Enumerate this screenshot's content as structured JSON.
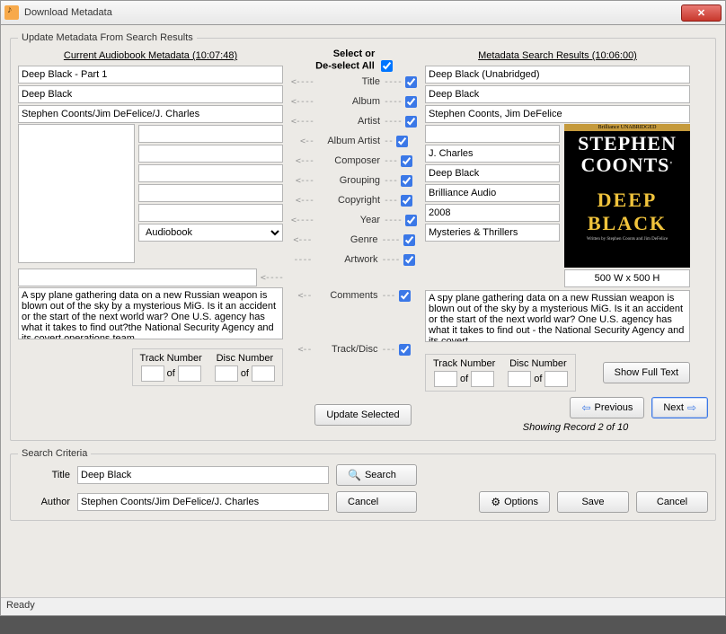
{
  "window": {
    "title": "Download Metadata"
  },
  "status": "Ready",
  "update_legend": "Update Metadata  From Search Results",
  "headers": {
    "left": "Current Audiobook Metadata (10:07:48)",
    "right": "Metadata Search Results (10:06:00)",
    "select_line1": "Select or",
    "select_line2": "De-select All"
  },
  "labels": {
    "title": "Title",
    "album": "Album",
    "artist": "Artist",
    "album_artist": "Album Artist",
    "composer": "Composer",
    "grouping": "Grouping",
    "copyright": "Copyright",
    "year": "Year",
    "genre": "Genre",
    "artwork": "Artwork",
    "comments": "Comments",
    "trackdisc": "Track/Disc",
    "tracknum": "Track Number",
    "discnum": "Disc Number",
    "of": "of"
  },
  "left": {
    "title": "Deep Black - Part 1",
    "album": "Deep Black",
    "artist": "Stephen Coonts/Jim DeFelice/J. Charles",
    "album_artist": "",
    "composer": "",
    "grouping": "",
    "copyright": "",
    "year": "",
    "genre": "Audiobook",
    "artwork": "",
    "comments": "A spy plane gathering data on a new Russian weapon is blown out of the sky by a mysterious MiG. Is it an accident or the start of the next world war? One U.S. agency has what it takes to find out?the National Security Agency and its covert operations team",
    "track_a": "",
    "track_b": "",
    "disc_a": "",
    "disc_b": ""
  },
  "right": {
    "title": "Deep Black (Unabridged)",
    "album": "Deep Black",
    "artist": "Stephen Coonts, Jim DeFelice",
    "album_artist": "",
    "composer": "J. Charles",
    "grouping": "Deep Black",
    "copyright": "Brilliance Audio",
    "year": "2008",
    "genre": "Mysteries & Thrillers",
    "artwork_dim": "500 W x 500 H",
    "comments": "A spy plane gathering data on a new Russian weapon is blown out of the sky by a mysterious MiG. Is it an accident or the start of the next world war? One U.S. agency has what it takes to find out - the National Security Agency and its covert...",
    "track_a": "",
    "track_b": "",
    "disc_a": "",
    "disc_b": ""
  },
  "cover": {
    "brand": "Brilliance  UNABRIDGED",
    "author1": "STEPHEN",
    "author2": "COONTS",
    "apos": "'",
    "line1": "DEEP",
    "line2": "BLACK",
    "credit": "Written by Stephen Coonts and Jim DeFelice"
  },
  "buttons": {
    "update": "Update Selected",
    "prev": "Previous",
    "next": "Next",
    "showfull": "Show Full Text",
    "search": "Search",
    "cancel": "Cancel",
    "options": "Options",
    "save": "Save"
  },
  "nav": {
    "record_info": "Showing Record 2 of 10"
  },
  "search": {
    "legend": "Search Criteria",
    "title_label": "Title",
    "author_label": "Author",
    "title": "Deep Black",
    "author": "Stephen Coonts/Jim DeFelice/J. Charles"
  }
}
